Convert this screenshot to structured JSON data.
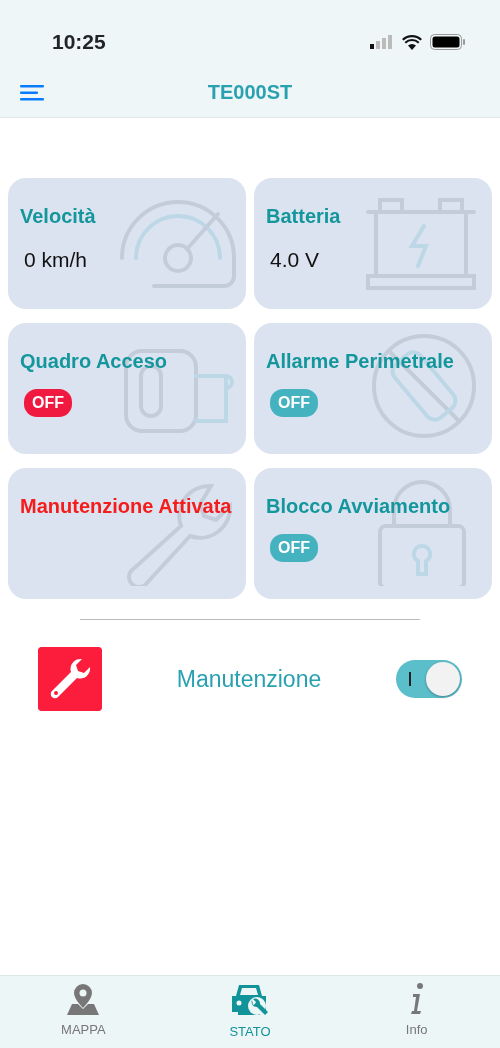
{
  "status_bar": {
    "time": "10:25"
  },
  "header": {
    "title": "TE000ST"
  },
  "cards": [
    {
      "kind": "reading",
      "title": "Velocità",
      "alert": false,
      "value": "0 km/h"
    },
    {
      "kind": "reading",
      "title": "Batteria",
      "alert": false,
      "value": "4.0 V"
    },
    {
      "kind": "switch",
      "title": "Quadro Acceso",
      "alert": false,
      "badge": {
        "text": "OFF",
        "color": "#f0193f"
      }
    },
    {
      "kind": "switch",
      "title": "Allarme Perimetrale",
      "alert": false,
      "badge": {
        "text": "OFF",
        "color": "#45b2c0"
      }
    },
    {
      "kind": "label",
      "title": "Manutenzione Attivata",
      "alert": true
    },
    {
      "kind": "switch",
      "title": "Blocco Avviamento",
      "alert": false,
      "badge": {
        "text": "OFF",
        "color": "#45b2c0"
      }
    }
  ],
  "maintenance": {
    "label": "Manutenzione",
    "on": true
  },
  "tabs": [
    {
      "label": "MAPPA",
      "selected": false
    },
    {
      "label": "STATO",
      "selected": true
    },
    {
      "label": "Info",
      "selected": false
    }
  ]
}
